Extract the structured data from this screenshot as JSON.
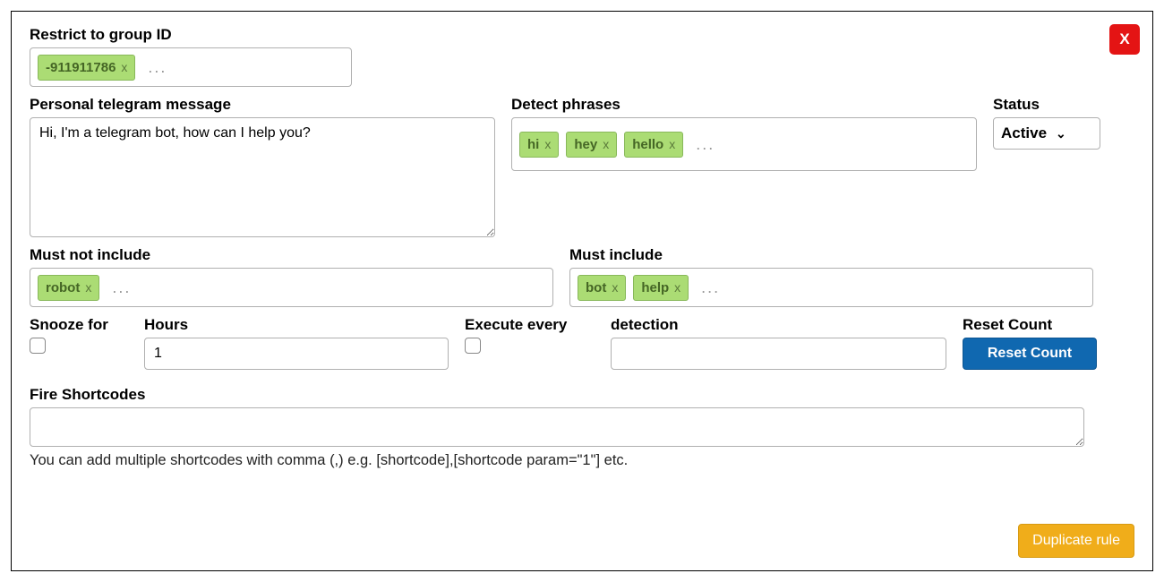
{
  "close_label": "X",
  "group_id": {
    "label": "Restrict to group ID",
    "tags": [
      "-911911786"
    ]
  },
  "message": {
    "label": "Personal telegram message",
    "value": "Hi, I'm a telegram bot, how can I help you?"
  },
  "detect": {
    "label": "Detect phrases",
    "tags": [
      "hi",
      "hey",
      "hello"
    ]
  },
  "status": {
    "label": "Status",
    "value": "Active"
  },
  "must_not": {
    "label": "Must not include",
    "tags": [
      "robot"
    ]
  },
  "must_include": {
    "label": "Must include",
    "tags": [
      "bot",
      "help"
    ]
  },
  "snooze": {
    "label": "Snooze for",
    "checked": false
  },
  "hours": {
    "label": "Hours",
    "value": "1"
  },
  "execute_every": {
    "label": "Execute every",
    "checked": false
  },
  "detection": {
    "label": "detection",
    "value": ""
  },
  "reset": {
    "label": "Reset Count",
    "button": "Reset Count"
  },
  "shortcodes": {
    "label": "Fire Shortcodes",
    "value": "",
    "helper": "You can add multiple shortcodes with comma (,) e.g. [shortcode],[shortcode param=\"1\"] etc."
  },
  "duplicate_label": "Duplicate rule",
  "tag_remove": "x",
  "dots": "..."
}
